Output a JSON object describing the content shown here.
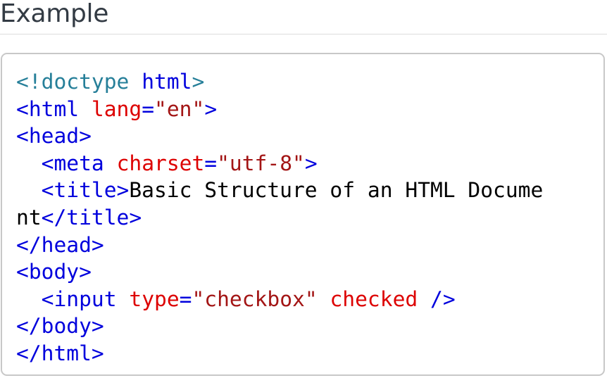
{
  "heading": "Example",
  "code": {
    "lines": [
      [
        {
          "cls": "tok-meta",
          "text": "<!doctype"
        },
        {
          "cls": "tok-text",
          "text": " "
        },
        {
          "cls": "tok-tag",
          "text": "html"
        },
        {
          "cls": "tok-meta",
          "text": ">"
        }
      ],
      [
        {
          "cls": "tok-tag",
          "text": "<html"
        },
        {
          "cls": "tok-text",
          "text": " "
        },
        {
          "cls": "tok-attr",
          "text": "lang"
        },
        {
          "cls": "tok-punc",
          "text": "="
        },
        {
          "cls": "tok-str",
          "text": "\"en\""
        },
        {
          "cls": "tok-tag",
          "text": ">"
        }
      ],
      [
        {
          "cls": "tok-tag",
          "text": "<head>"
        }
      ],
      [
        {
          "cls": "tok-text",
          "text": "  "
        },
        {
          "cls": "tok-tag",
          "text": "<meta"
        },
        {
          "cls": "tok-text",
          "text": " "
        },
        {
          "cls": "tok-attr",
          "text": "charset"
        },
        {
          "cls": "tok-punc",
          "text": "="
        },
        {
          "cls": "tok-str",
          "text": "\"utf-8\""
        },
        {
          "cls": "tok-tag",
          "text": ">"
        }
      ],
      [
        {
          "cls": "tok-text",
          "text": "  "
        },
        {
          "cls": "tok-tag",
          "text": "<title>"
        },
        {
          "cls": "tok-text",
          "text": "Basic Structure of an HTML Docume"
        }
      ],
      [
        {
          "cls": "tok-text",
          "text": "nt"
        },
        {
          "cls": "tok-tag",
          "text": "</title>"
        }
      ],
      [
        {
          "cls": "tok-tag",
          "text": "</head>"
        }
      ],
      [
        {
          "cls": "tok-tag",
          "text": "<body>"
        }
      ],
      [
        {
          "cls": "tok-text",
          "text": "  "
        },
        {
          "cls": "tok-tag",
          "text": "<input"
        },
        {
          "cls": "tok-text",
          "text": " "
        },
        {
          "cls": "tok-attr",
          "text": "type"
        },
        {
          "cls": "tok-punc",
          "text": "="
        },
        {
          "cls": "tok-str",
          "text": "\"checkbox\""
        },
        {
          "cls": "tok-text",
          "text": " "
        },
        {
          "cls": "tok-attr",
          "text": "checked"
        },
        {
          "cls": "tok-text",
          "text": " "
        },
        {
          "cls": "tok-tag",
          "text": "/>"
        }
      ],
      [
        {
          "cls": "tok-tag",
          "text": "</body>"
        }
      ],
      [
        {
          "cls": "tok-tag",
          "text": "</html>"
        }
      ]
    ]
  }
}
